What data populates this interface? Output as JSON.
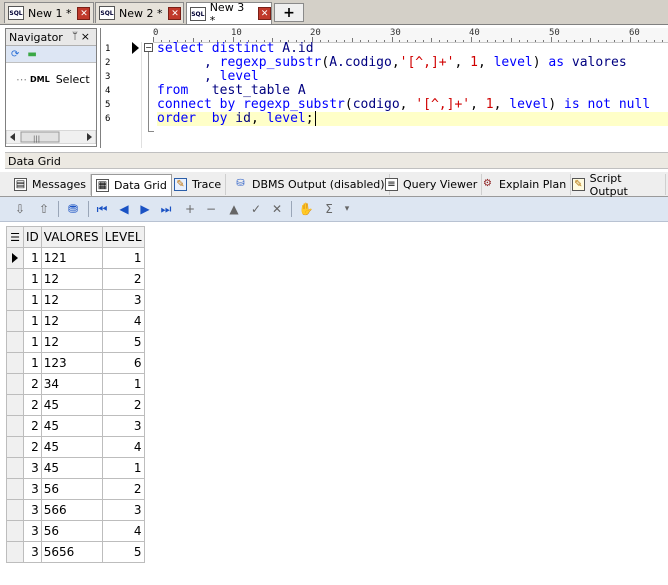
{
  "doc_tabs": [
    {
      "icon": "SQL",
      "label": "New 1 *",
      "active": false
    },
    {
      "icon": "SQL",
      "label": "New 2 *",
      "active": false
    },
    {
      "icon": "SQL",
      "label": "New 3 *",
      "active": true
    }
  ],
  "doc_tabs_add": "+",
  "navigator": {
    "title": "Navigator",
    "pin": "ᛘ",
    "close": "×",
    "item_badge": "DML",
    "item_label": "Select",
    "scroll_thumb": "|||"
  },
  "editor": {
    "ruler_marks": [
      "0",
      "10",
      "20",
      "30",
      "40",
      "50",
      "60"
    ],
    "line_numbers": [
      "1",
      "2",
      "3",
      "4",
      "5",
      "6"
    ]
  },
  "data_grid_label": "Data Grid",
  "bottom_tabs": [
    {
      "label": "Messages",
      "icon": "messages-icon",
      "active": false
    },
    {
      "label": "Data Grid",
      "icon": "data-grid-icon",
      "active": true
    },
    {
      "label": "Trace",
      "icon": "trace-icon",
      "active": false
    },
    {
      "label": "DBMS Output (disabled)",
      "icon": "dbms-output-icon",
      "active": false
    },
    {
      "label": "Query Viewer",
      "icon": "query-viewer-icon",
      "active": false
    },
    {
      "label": "Explain Plan",
      "icon": "explain-plan-icon",
      "active": false
    },
    {
      "label": "Script Output",
      "icon": "script-output-icon",
      "active": false
    }
  ],
  "grid": {
    "columns": [
      "ID",
      "VALORES",
      "LEVEL"
    ],
    "rows": [
      [
        "1",
        "121",
        "1"
      ],
      [
        "1",
        "12",
        "2"
      ],
      [
        "1",
        "12",
        "3"
      ],
      [
        "1",
        "12",
        "4"
      ],
      [
        "1",
        "12",
        "5"
      ],
      [
        "1",
        "123",
        "6"
      ],
      [
        "2",
        "34",
        "1"
      ],
      [
        "2",
        "45",
        "2"
      ],
      [
        "2",
        "45",
        "3"
      ],
      [
        "2",
        "45",
        "4"
      ],
      [
        "3",
        "45",
        "1"
      ],
      [
        "3",
        "56",
        "2"
      ],
      [
        "3",
        "566",
        "3"
      ],
      [
        "3",
        "56",
        "4"
      ],
      [
        "3",
        "5656",
        "5"
      ]
    ]
  }
}
